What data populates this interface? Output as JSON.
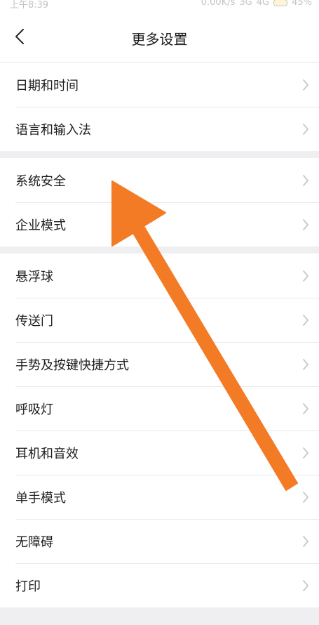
{
  "status_bar": {
    "time": "上午8:39",
    "network_speed": "0.00K/s",
    "network_type_1": "3G",
    "network_type_2": "4G",
    "battery": "45%"
  },
  "header": {
    "title": "更多设置",
    "back_icon": "chevron-left-icon"
  },
  "groups": [
    {
      "items": [
        {
          "label": "日期和时间"
        },
        {
          "label": "语言和输入法"
        }
      ]
    },
    {
      "items": [
        {
          "label": "系统安全"
        },
        {
          "label": "企业模式"
        }
      ]
    },
    {
      "items": [
        {
          "label": "悬浮球"
        },
        {
          "label": "传送门"
        },
        {
          "label": "手势及按键快捷方式"
        },
        {
          "label": "呼吸灯"
        },
        {
          "label": "耳机和音效"
        },
        {
          "label": "单手模式"
        },
        {
          "label": "无障碍"
        },
        {
          "label": "打印"
        }
      ]
    }
  ],
  "annotation": {
    "arrow_color": "#f47b26",
    "points_to": "系统安全"
  },
  "colors": {
    "background": "#efeff1",
    "row_background": "#ffffff",
    "text": "#1d1d1d",
    "chevron": "#c8c8c8"
  }
}
